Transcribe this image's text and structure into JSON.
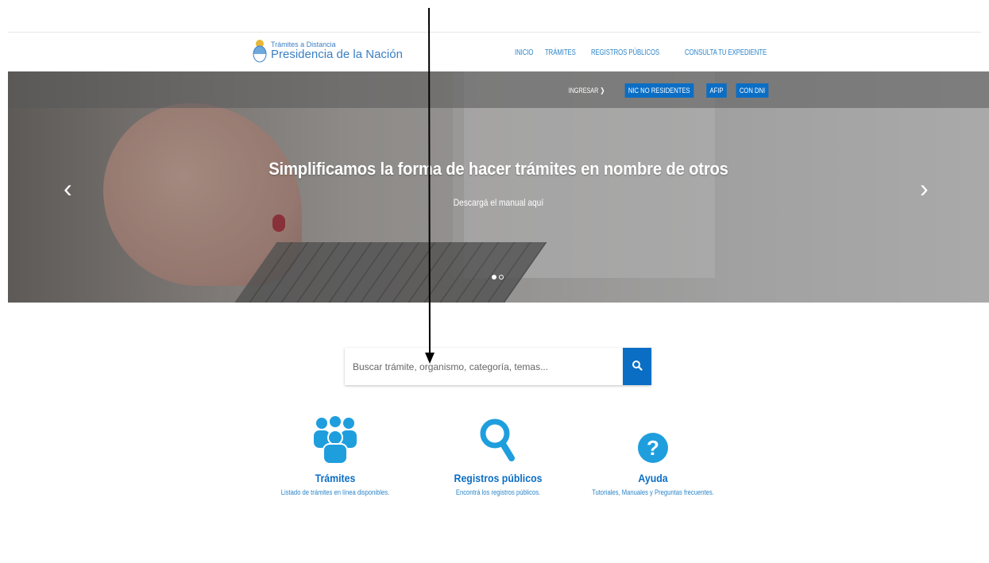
{
  "header": {
    "logo_line1": "Trámites a Distancia",
    "logo_line2": "Presidencia de la Nación",
    "nav": [
      "INICIO",
      "TRÁMITES",
      "REGISTROS PÚBLICOS",
      "CONSULTA TU EXPEDIENTE"
    ]
  },
  "login": {
    "ingresar": "INGRESAR",
    "buttons": [
      "NIC NO RESIDENTES",
      "AFIP",
      "CON DNI"
    ]
  },
  "hero": {
    "title": "Simplificamos la forma de hacer trámites en nombre de otros",
    "subtitle": "Descargá el manual aquí",
    "slides": 2,
    "active_slide": 1
  },
  "search": {
    "placeholder": "Buscar trámite, organismo, categoría, temas..."
  },
  "features": [
    {
      "title": "Trámites",
      "desc": "Listado de trámites en línea disponibles.",
      "icon": "users-icon"
    },
    {
      "title": "Registros públicos",
      "desc": "Encontrá los registros públicos.",
      "icon": "search-icon"
    },
    {
      "title": "Ayuda",
      "desc": "Tutoriales, Manuales y Preguntas frecuentes.",
      "icon": "question-icon"
    }
  ],
  "colors": {
    "primary": "#0b6ec5",
    "icon": "#1f9ede",
    "link": "#2d86c9"
  }
}
